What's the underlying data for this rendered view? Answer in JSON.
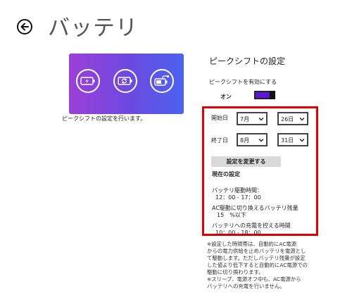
{
  "page": {
    "title": "バッテリ"
  },
  "hero": {
    "caption": "ピークシフトの設定を行います。"
  },
  "settings": {
    "title": "ピークシフトの設定",
    "toggle_label": "ピークシフトを有効にする",
    "toggle_state": "オン",
    "start_label": "開始日",
    "start_month": "7月",
    "start_day": "26日",
    "end_label": "終了日",
    "end_month": "8月",
    "end_day": "31日",
    "change_button": "設定を変更する",
    "current_title": "現在の設定",
    "drive_time_label": "バッテリ駆動時間：",
    "drive_time_value": "12：00 - 17：00",
    "switch_label": "AC駆動に切り換えるバッテリ残量",
    "switch_value": "15　%以下",
    "charge_label": "バッテリへの充電を控える時間",
    "charge_value": "10：00 - 18：00"
  },
  "note": {
    "lines": [
      "※設定した時間帯は、自動的にAC電源",
      "からの電力供給を止めバッテリを電源とし",
      "て駆動します。ただしバッテリ残量が設定",
      "した値より低下すると自動的にAC電源での",
      "駆動に切り換わります。",
      "※スリープ、電源オフ中も、AC電源から",
      "バッテリへの充電を行いません。"
    ]
  },
  "colors": {
    "highlight": "#e00000",
    "toggle": "#5a17d6",
    "hero_start": "#9b3fd8",
    "hero_end": "#4d63ee"
  }
}
